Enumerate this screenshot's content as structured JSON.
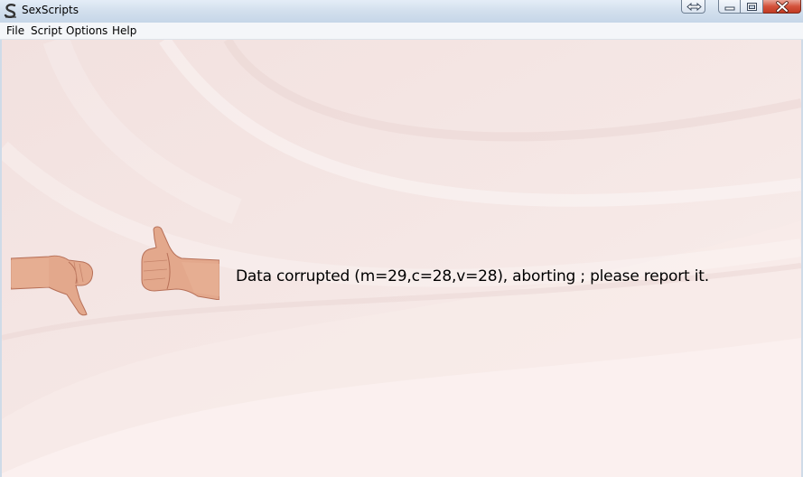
{
  "window": {
    "title": "SexScripts",
    "icon": "app-s-icon",
    "caption_buttons": [
      "snap-icon",
      "minimize-icon",
      "maximize-icon",
      "close-icon"
    ]
  },
  "menubar": {
    "items": [
      {
        "label": "File"
      },
      {
        "label": "Script"
      },
      {
        "label": "Options"
      },
      {
        "label": "Help"
      }
    ]
  },
  "main": {
    "left_image": "thumbs-down-hand",
    "right_image": "thumbs-up-hand",
    "message": "Data corrupted (m=29,c=28,v=28), aborting ; please report it."
  },
  "colors": {
    "background": "#f6e9e7",
    "close_button": "#c8432b",
    "titlebar": "#d2dfed"
  }
}
